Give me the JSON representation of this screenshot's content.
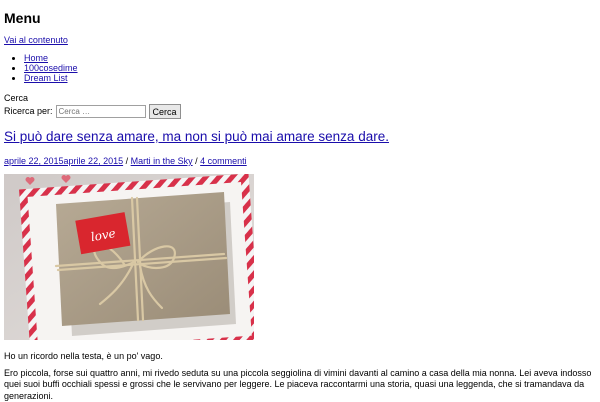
{
  "header": {
    "title": "Menu",
    "skip_link": "Vai al contenuto"
  },
  "nav": {
    "items": [
      {
        "label": "Home"
      },
      {
        "label": "100cosedime"
      },
      {
        "label": "Dream List"
      }
    ]
  },
  "search": {
    "title": "Cerca",
    "label": "Ricerca per:",
    "placeholder": "Cerca …",
    "button_label": "Cerca"
  },
  "post": {
    "title": "Si può dare senza amare, ma non si può mai amare senza dare.",
    "date_text": "aprile 22, 2015aprile 22, 2015",
    "separator1": " / ",
    "category": "Marti in the Sky",
    "separator2": " / ",
    "comments": "4 commenti",
    "image": {
      "tag_text": "love"
    },
    "intro": "Ho un ricordo nella testa, è un po' vago.",
    "paragraph": "Ero piccola, forse sui quattro anni, mi rivedo seduta su una piccola seggiolina di vimini davanti al camino a casa della mia nonna. Lei aveva indosso quei suoi buffi occhiali spessi e grossi che le servivano per leggere. Le piaceva raccontarmi una storia, quasi una leggenda, che si tramandava da generazioni."
  },
  "colors": {
    "link": "#1a0dab",
    "tag_red": "#d9262e",
    "kraft": "#a99b86",
    "envelope_stripe": "#d8314a"
  }
}
